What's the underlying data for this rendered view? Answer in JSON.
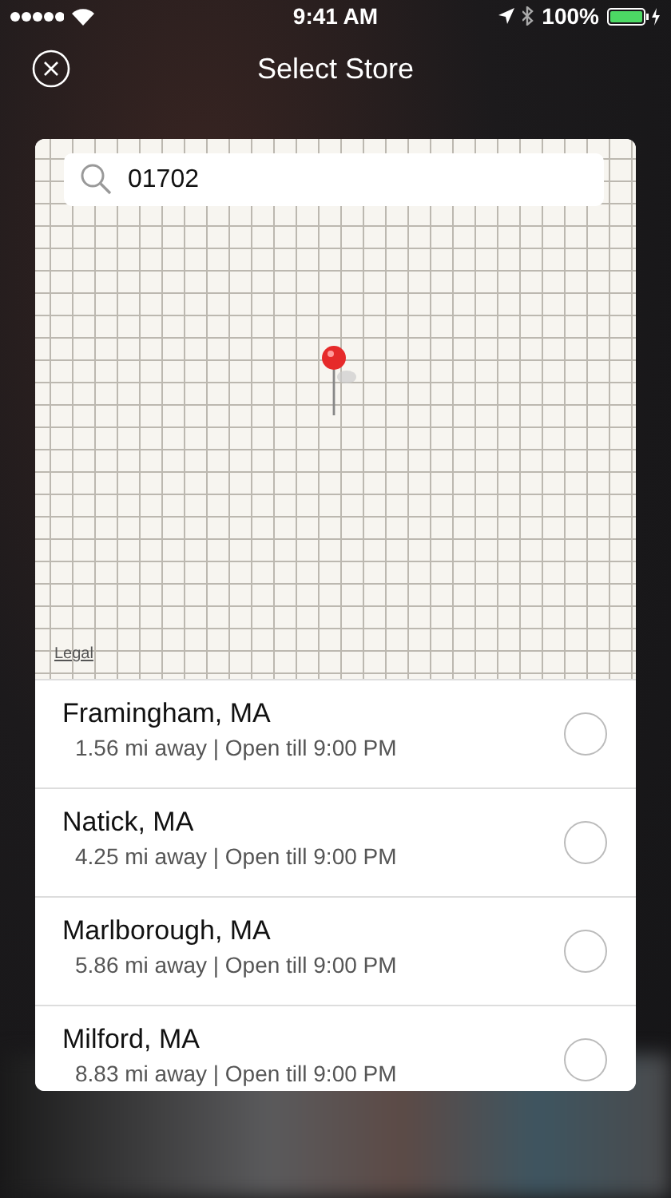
{
  "status_bar": {
    "time": "9:41 AM",
    "battery": "100%"
  },
  "header": {
    "title": "Select Store"
  },
  "search": {
    "value": "01702"
  },
  "map": {
    "legal": "Legal"
  },
  "stores": [
    {
      "name": "Framingham, MA",
      "detail": "1.56 mi away | Open till 9:00 PM",
      "selected": false
    },
    {
      "name": "Natick, MA",
      "detail": "4.25 mi away | Open till 9:00 PM",
      "selected": false
    },
    {
      "name": "Marlborough, MA",
      "detail": "5.86 mi away | Open till 9:00 PM",
      "selected": false
    },
    {
      "name": "Milford, MA",
      "detail": "8.83 mi away | Open till 9:00 PM",
      "selected": false
    }
  ]
}
